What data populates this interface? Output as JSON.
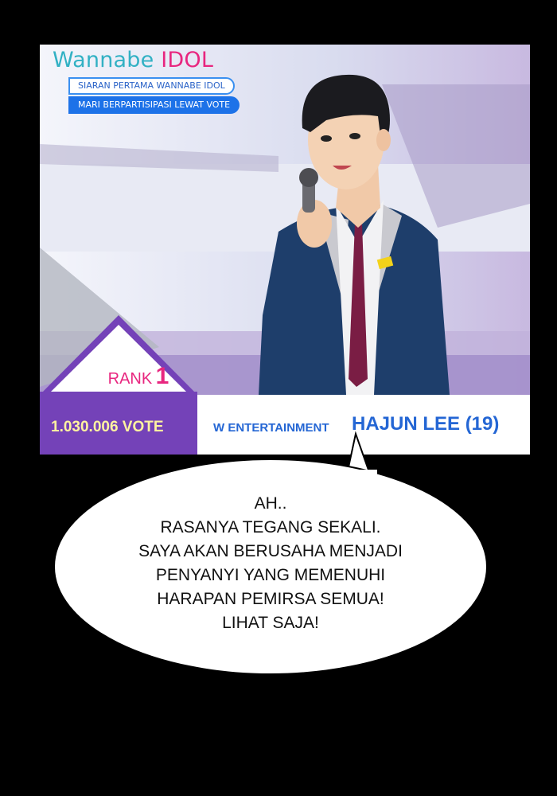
{
  "banner": {
    "logo_word": "Wannabe",
    "logo_idol": "IDOL",
    "line1": "SIARAN PERTAMA WANNABE IDOL",
    "line2": "MARI BERPARTISIPASI LEWAT VOTE"
  },
  "rank": {
    "label": "RANK",
    "value": "1"
  },
  "vote": "1.030.006 VOTE",
  "contestant": {
    "company": "W ENTERTAINMENT",
    "name": "HAJUN LEE (19)"
  },
  "speech": {
    "lines": [
      "AH..",
      "RASANYA TEGANG SEKALI.",
      "SAYA AKAN BERUSAHA MENJADI",
      "PENYANYI YANG MEMENUHI",
      "HARAPAN PEMIRSA SEMUA!",
      "LIHAT SAJA!"
    ]
  },
  "colors": {
    "idol_pink": "#e8267f",
    "logo_teal": "#32b1c4",
    "purple": "#7442b8",
    "blue": "#2466d4",
    "vote_yellow": "#fff3a0"
  }
}
